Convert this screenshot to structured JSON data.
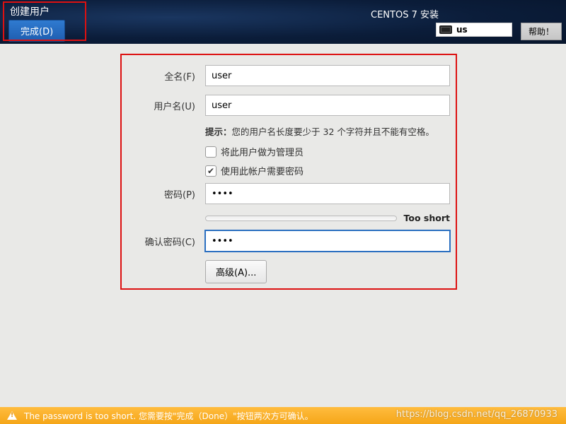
{
  "header": {
    "title": "创建用户",
    "done_label": "完成(D)",
    "install_title": "CENTOS 7 安装",
    "keyboard_layout": "us",
    "help_label": "帮助！"
  },
  "form": {
    "fullname_label": "全名(F)",
    "fullname_value": "user",
    "username_label": "用户名(U)",
    "username_value": "user",
    "tip_prefix": "提示：",
    "tip_text": "您的用户名长度要少于 32 个字符并且不能有空格。",
    "checkbox_admin": "将此用户做为管理员",
    "checkbox_require_pwd": "使用此帐户需要密码",
    "admin_checked": false,
    "require_pwd_checked": true,
    "password_label": "密码(P)",
    "password_value": "••••",
    "strength_label": "Too short",
    "strength_percent": 0,
    "confirm_label": "确认密码(C)",
    "confirm_value": "••••",
    "advanced_label": "高级(A)..."
  },
  "warning": {
    "text": "The password is too short. 您需要按\"完成（Done）\"按钮两次方可确认。"
  },
  "watermark": "https://blog.csdn.net/qq_26870933",
  "colors": {
    "header_bg": "#0b1d3a",
    "accent": "#1f5eb0",
    "highlight": "#d11",
    "warn_bg": "#f5a618"
  }
}
